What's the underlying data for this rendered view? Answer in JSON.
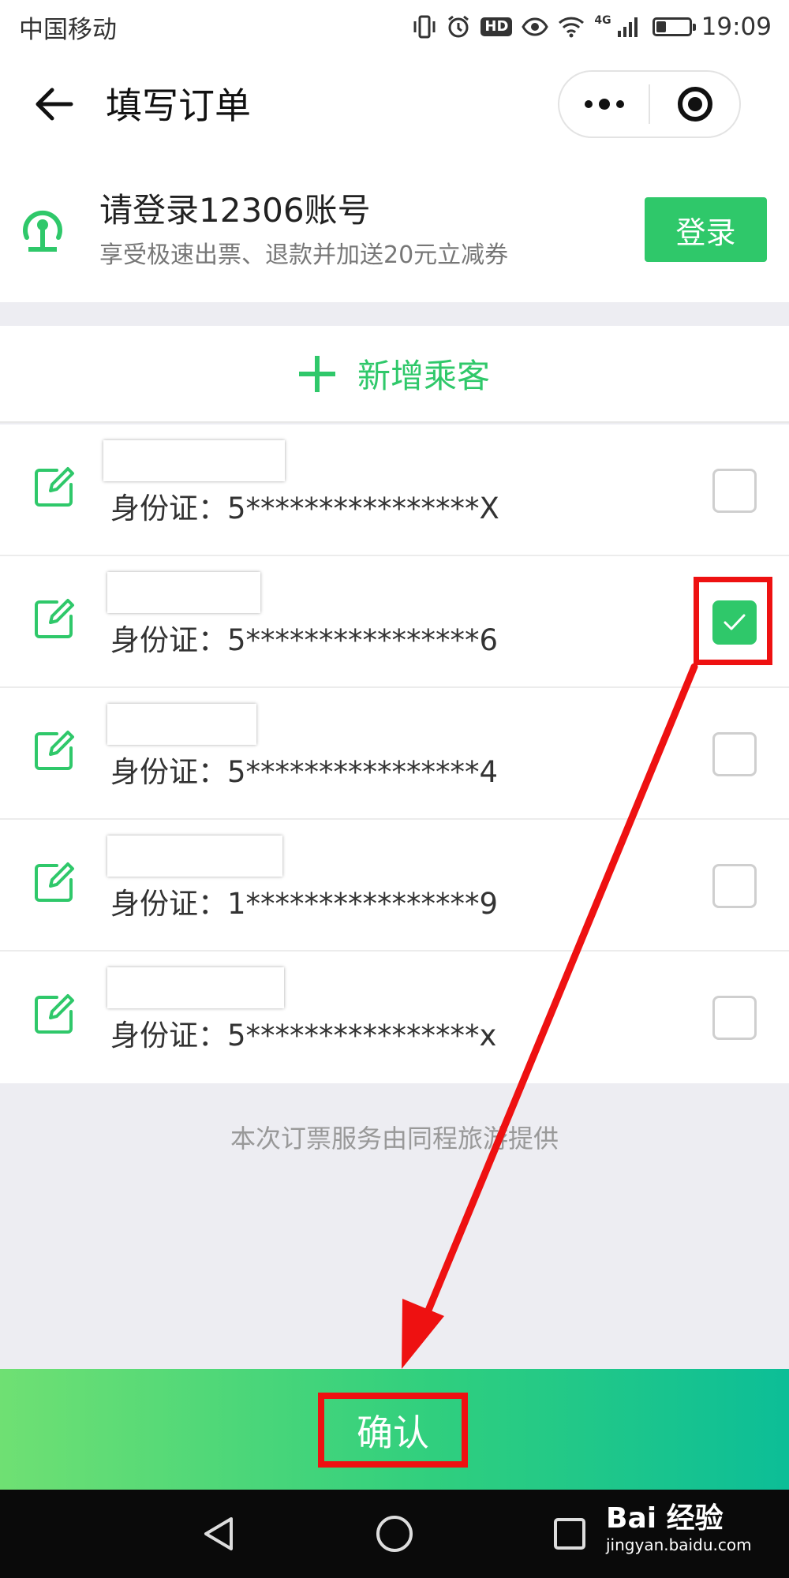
{
  "status_bar": {
    "carrier": "中国移动",
    "time": "19:09",
    "icons": [
      "vibrate-icon",
      "alarm-icon",
      "hd-icon",
      "eye-icon",
      "wifi-icon",
      "signal-4g-icon",
      "battery-icon"
    ],
    "hd_label": "HD",
    "network_label": "4G",
    "battery_level": 0.3
  },
  "header": {
    "title": "填写订单"
  },
  "login_card": {
    "title": "请登录12306账号",
    "subtitle": "享受极速出票、退款并加送20元立减券",
    "button_label": "登录"
  },
  "add_passenger": {
    "label": "新增乘客"
  },
  "passengers": [
    {
      "id_line": "身份证：5****************X",
      "checked": false
    },
    {
      "id_line": "身份证：5****************6",
      "checked": true
    },
    {
      "id_line": "身份证：5****************4",
      "checked": false
    },
    {
      "id_line": "身份证：1****************9",
      "checked": false
    },
    {
      "id_line": "身份证：5****************x",
      "checked": false
    }
  ],
  "footer_note": "本次订票服务由同程旅游提供",
  "confirm": {
    "label": "确认"
  },
  "watermark": {
    "brand": "Bai 经验",
    "url": "jingyan.baidu.com"
  },
  "colors": {
    "accent": "#2fc86a",
    "annotation": "#ee1111"
  }
}
